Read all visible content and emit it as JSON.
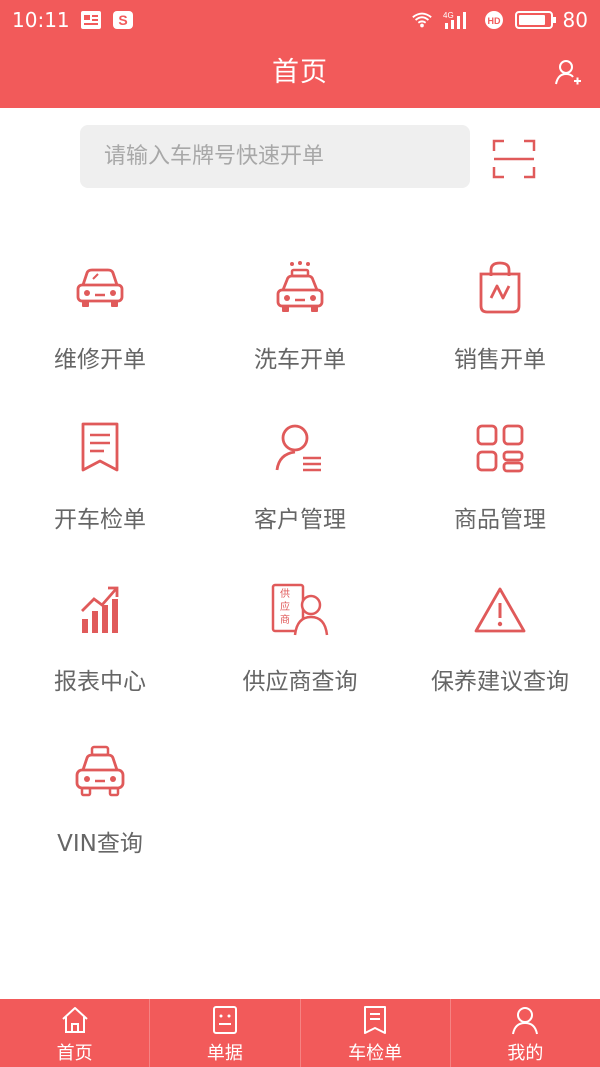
{
  "status_bar": {
    "time": "10:11",
    "battery": "80",
    "network": "4G"
  },
  "header": {
    "title": "首页"
  },
  "search": {
    "placeholder": "请输入车牌号快速开单"
  },
  "grid": [
    {
      "label": "维修开单",
      "icon": "car-icon"
    },
    {
      "label": "洗车开单",
      "icon": "car-wash-icon"
    },
    {
      "label": "销售开单",
      "icon": "shopping-bag-icon"
    },
    {
      "label": "开车检单",
      "icon": "document-icon"
    },
    {
      "label": "客户管理",
      "icon": "customer-icon"
    },
    {
      "label": "商品管理",
      "icon": "grid-apps-icon"
    },
    {
      "label": "报表中心",
      "icon": "chart-icon"
    },
    {
      "label": "供应商查询",
      "icon": "supplier-icon"
    },
    {
      "label": "保养建议查询",
      "icon": "warning-icon"
    },
    {
      "label": "VIN查询",
      "icon": "taxi-icon"
    }
  ],
  "tabs": [
    {
      "label": "首页",
      "icon": "home-icon"
    },
    {
      "label": "单据",
      "icon": "receipt-icon"
    },
    {
      "label": "车检单",
      "icon": "checklist-icon"
    },
    {
      "label": "我的",
      "icon": "user-icon"
    }
  ],
  "colors": {
    "primary": "#f25a5a",
    "icon": "#e05a5a",
    "label": "#666666"
  }
}
